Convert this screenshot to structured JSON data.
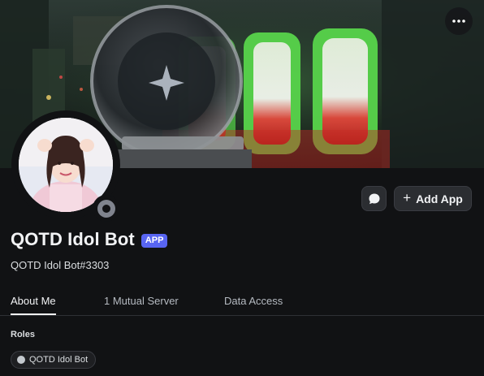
{
  "profile": {
    "display_name": "QOTD Idol Bot",
    "badge": "APP",
    "username": "QOTD Idol Bot#3303",
    "status": "offline"
  },
  "banner": {
    "description_icon": "banner-image"
  },
  "actions": {
    "more_icon": "more-options-icon",
    "message_icon": "message-icon",
    "add_app_label": "Add App",
    "add_app_icon": "plus-icon"
  },
  "tabs": [
    {
      "label": "About Me",
      "active": true
    },
    {
      "label": "1 Mutual Server",
      "active": false
    },
    {
      "label": "Data Access",
      "active": false
    }
  ],
  "roles": {
    "heading": "Roles",
    "items": [
      {
        "label": "QOTD Idol Bot",
        "color": "#c4c9ce"
      }
    ]
  },
  "colors": {
    "background": "#111214",
    "badge": "#5865f2",
    "button": "#2b2d31"
  }
}
